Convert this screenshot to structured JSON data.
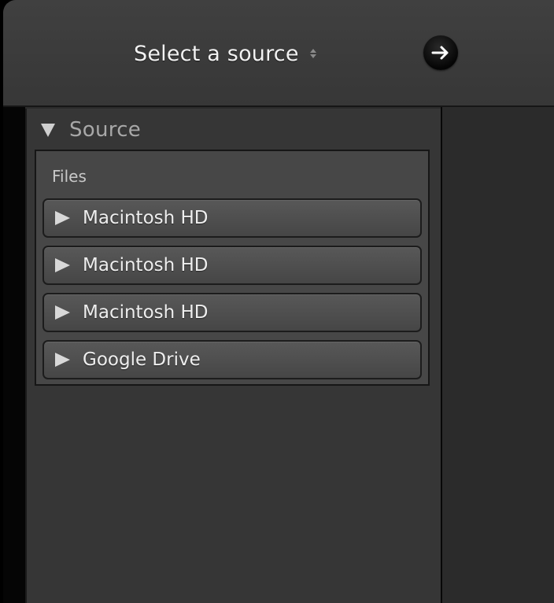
{
  "toolbar": {
    "source_select_label": "Select a source",
    "source_select_icon": "updown-chevron-icon",
    "go_button_icon": "arrow-right-icon"
  },
  "source_panel": {
    "title": "Source",
    "header_icon": "disclosure-down-icon",
    "files": {
      "label": "Files",
      "items": [
        {
          "label": "Macintosh HD",
          "icon": "disclosure-right-icon"
        },
        {
          "label": "Macintosh HD",
          "icon": "disclosure-right-icon"
        },
        {
          "label": "Macintosh HD",
          "icon": "disclosure-right-icon"
        },
        {
          "label": "Google Drive",
          "icon": "disclosure-right-icon"
        }
      ]
    }
  },
  "colors": {
    "window_bg": "#2b2b2b",
    "toolbar_bg": "#3c3c3c",
    "panel_bg": "#363636",
    "files_box_bg": "#474747",
    "text_primary": "#eeeeee",
    "text_muted": "#a8a8a8"
  }
}
